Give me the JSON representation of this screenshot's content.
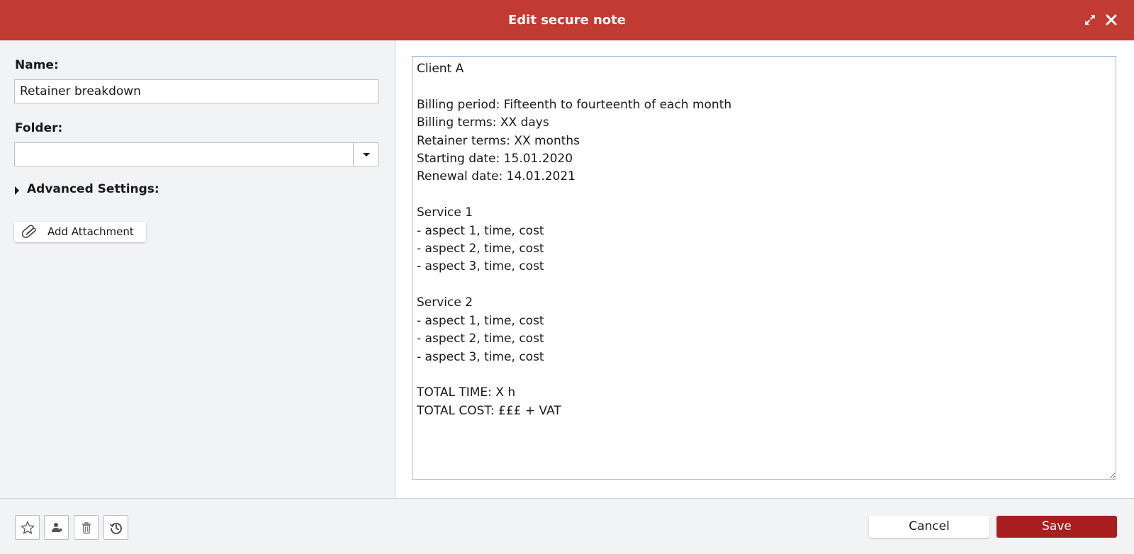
{
  "header": {
    "title": "Edit secure note",
    "background_color": "#c23b33"
  },
  "form": {
    "name_label": "Name:",
    "name_value": "Retainer breakdown",
    "folder_label": "Folder:",
    "folder_value": "",
    "advanced_settings_label": "Advanced Settings:",
    "add_attachment_label": "Add Attachment"
  },
  "note": {
    "content": "Client A\n\nBilling period: Fifteenth to fourteenth of each month\nBilling terms: XX days\nRetainer terms: XX months\nStarting date: 15.01.2020\nRenewal date: 14.01.2021\n\nService 1\n- aspect 1, time, cost\n- aspect 2, time, cost\n- aspect 3, time, cost\n\nService 2\n- aspect 1, time, cost\n- aspect 2, time, cost\n- aspect 3, time, cost\n\nTOTAL TIME: X h\nTOTAL COST: £££ + VAT"
  },
  "footer": {
    "icons": [
      "star-icon",
      "share-icon",
      "trash-icon",
      "history-icon"
    ],
    "cancel_label": "Cancel",
    "save_label": "Save",
    "save_color": "#a81e1e"
  }
}
